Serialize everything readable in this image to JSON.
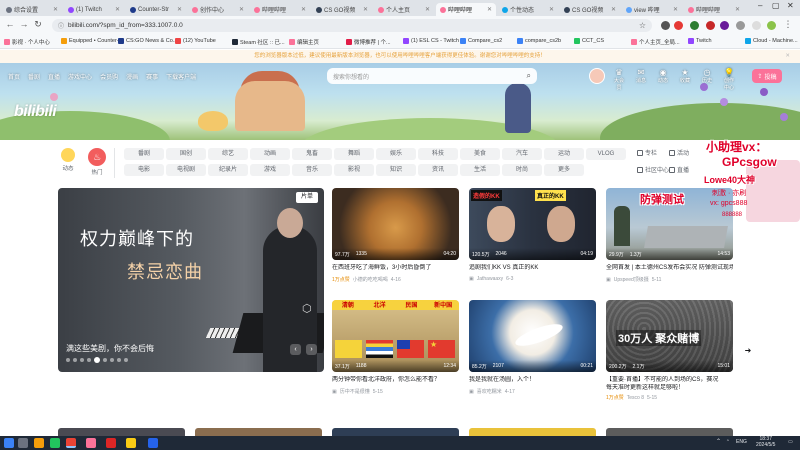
{
  "browser": {
    "tabs": [
      {
        "label": "综合设置",
        "active": false
      },
      {
        "label": "(1) Twitch",
        "active": false
      },
      {
        "label": "Counter-Str",
        "active": false
      },
      {
        "label": "创作中心",
        "active": false
      },
      {
        "label": "哔哩哔哩",
        "active": false
      },
      {
        "label": "CS GO视频",
        "active": false
      },
      {
        "label": "个人主页",
        "active": false
      },
      {
        "label": "哔哩哔哩",
        "active": true
      },
      {
        "label": "个性动态",
        "active": false
      },
      {
        "label": "CS GO视频",
        "active": false
      },
      {
        "label": "view 哔哩",
        "active": false
      },
      {
        "label": "哔哩哔哩",
        "active": false
      }
    ],
    "url": "bilibili.com/?spm_id_from=333.1007.0.0",
    "bookmarks": [
      "影视 · 个人中心",
      "Equipped • Counter-...",
      "CS:GO News & Co...",
      "(12) YouTube",
      "Steam 社区 :: 已...",
      "编辑主页",
      "微博推荐 | 个...",
      "(1) ESL CS - Twitch",
      "Compare_cs2",
      "compare_cs2b",
      "CCT_CS",
      "个人主页_全局...",
      "Twitch",
      "Cloud - Machine..."
    ]
  },
  "notice": "您的浏览器版本过低，建议使用最新版本浏览器，也可以使用哔哩哔哩客户端获得更佳体验。谢谢您对哔哩哔哩的支持！",
  "header": {
    "logo": "bilibili",
    "nav": [
      "首页",
      "番剧",
      "直播",
      "游戏中心",
      "会员购",
      "漫画",
      "赛事",
      "下载客户端"
    ],
    "search_placeholder": "搜索你想看的",
    "user_icons": [
      "大会员",
      "消息",
      "动态",
      "收藏",
      "历史",
      "创作中心"
    ],
    "upload": "投稿"
  },
  "channels": {
    "dynamic": "动态",
    "hot": "热门",
    "chips": [
      "番剧",
      "国创",
      "综艺",
      "动画",
      "鬼畜",
      "舞蹈",
      "娱乐",
      "科技",
      "美食",
      "汽车",
      "运动",
      "VLOG",
      "电影",
      "电视剧",
      "纪录片",
      "游戏",
      "音乐",
      "影视",
      "知识",
      "资讯",
      "生活",
      "时尚",
      "更多"
    ],
    "side": [
      "专栏",
      "活动",
      "社区中心",
      "直播"
    ]
  },
  "carousel": {
    "title_line1": "权力巅峰下的",
    "title_line2": "禁忌恋曲",
    "badge": "片单",
    "caption": "满这些美剧，你不会后悔"
  },
  "videos": [
    {
      "title": "在西班牙吃了海鲜饭，3小时后昏倒了",
      "views": "97.7万",
      "danmaku": "1335",
      "duration": "04:20",
      "author": "小德的吃吃喝喝",
      "date": "4-16",
      "tag": "1万点赞"
    },
    {
      "title": "追剧我们KK VS 真正的KK",
      "views": "120.5万",
      "danmaku": "2046",
      "duration": "04:19",
      "author": "Jathawaaxy",
      "date": "6-3",
      "tag": ""
    },
    {
      "title": "全网首发 | 本土德州CS发布会实况 防弹测试现场结果",
      "title2": "",
      "views": "29.9万",
      "danmaku": "1.3万",
      "duration": "14:53",
      "author": "Upspeed顶级摄",
      "date": "5-11",
      "tag": ""
    },
    {
      "title": "两分钟带你看北洋政府，你怎么能不看？",
      "views": "37.1万",
      "danmaku": "1188",
      "duration": "12:34",
      "author": "历中不是很懂",
      "date": "5-15",
      "tag": ""
    },
    {
      "title": "我是我就在汤圆，入个！",
      "views": "85.2万",
      "danmaku": "2107",
      "duration": "00:21",
      "author": "喜欢吃糯米",
      "date": "4-17",
      "tag": ""
    },
    {
      "title": "【重要·首播】不可能的人到场的CS，赛况",
      "title2": "每天准时更新这样就足够啦！",
      "views": "200.2万",
      "danmaku": "2.1万",
      "duration": "15:01",
      "author": "Tesco 8",
      "date": "5-15",
      "tag": "1万点赞"
    }
  ],
  "overlays": {
    "v1_left": "造假的KK",
    "v1_right": "真正的KK",
    "v3": "防弹测试",
    "v4_top": [
      "清朝",
      "北洋",
      "民国",
      "新中国"
    ],
    "v6": "30万人 聚众赌博"
  },
  "promo": {
    "line1": "小助理vx：",
    "line2": "GPcsgow",
    "line3": "Lowe40大神",
    "line4": "刺激 · 亦刷",
    "line5": "vx: gpcs888",
    "line6": "888888"
  },
  "taskbar": {
    "ime": "ENG",
    "time": "18:37",
    "date": "2024/5/5"
  },
  "colors": {
    "accent": "#fb7299",
    "hot": "#f25d5d",
    "promo": "#e0002a"
  }
}
